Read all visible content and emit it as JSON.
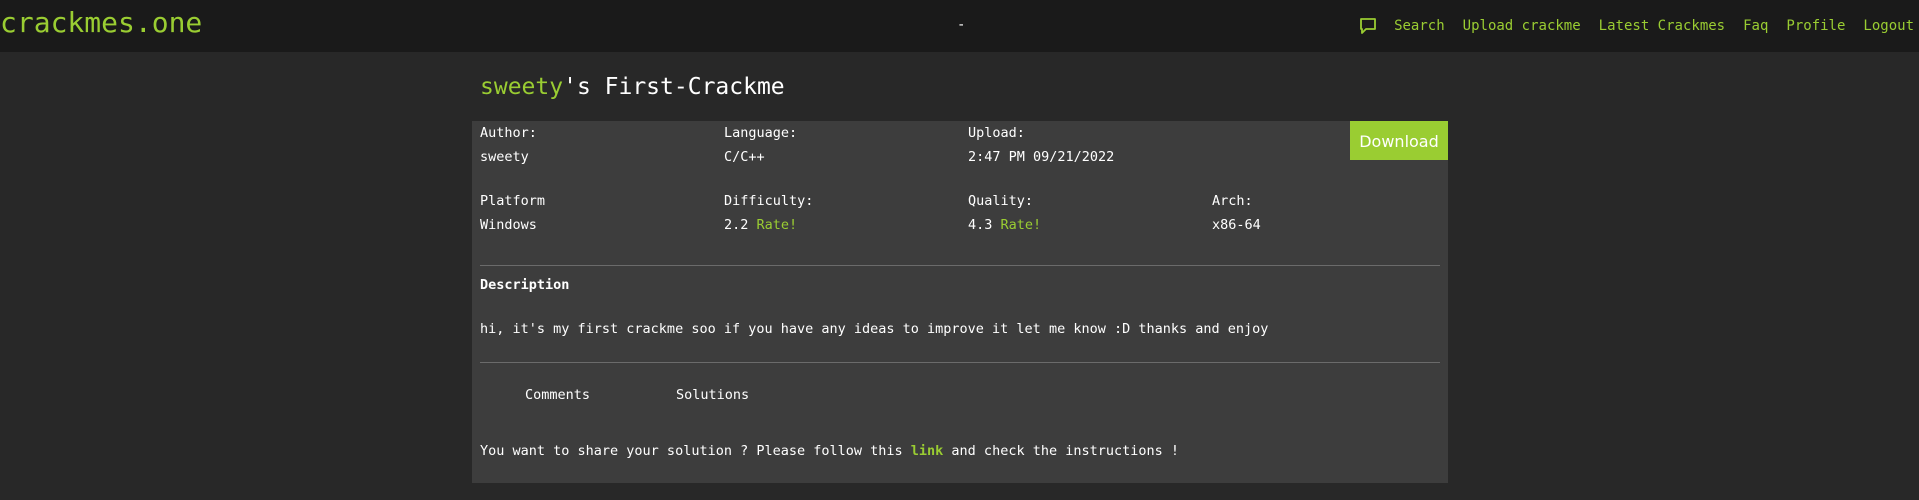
{
  "navbar": {
    "brand": "crackmes.one",
    "center_text": "-",
    "links": [
      "Search",
      "Upload crackme",
      "Latest Crackmes",
      "Faq",
      "Profile",
      "Logout"
    ],
    "chat_icon": "chat-bubble-icon"
  },
  "title": {
    "author": "sweety",
    "rest": "'s First-Crackme"
  },
  "download_label": "Download",
  "info": {
    "author_label": "Author:",
    "author_value": "sweety",
    "language_label": "Language:",
    "language_value": "C/C++",
    "upload_label": "Upload:",
    "upload_value": "2:47 PM 09/21/2022",
    "platform_label": "Platform",
    "platform_value": "Windows",
    "difficulty_label": "Difficulty:",
    "difficulty_value": "2.2",
    "quality_label": "Quality:",
    "quality_value": "4.3",
    "rate_label": "Rate!",
    "arch_label": "Arch:",
    "arch_value": "x86-64"
  },
  "description": {
    "title": "Description",
    "text": "hi, it's my first crackme soo if you have any ideas to improve it let me know :D thanks and enjoy"
  },
  "tabs": [
    "Comments",
    "Solutions"
  ],
  "share": {
    "before": "You want to share your solution ? Please follow this ",
    "link": "link",
    "after": " and check the instructions !"
  },
  "colors": {
    "accent": "#9acd32",
    "navbar_bg": "#1a1a1a",
    "page_bg": "#282828",
    "panel_bg": "#3d3d3d"
  }
}
